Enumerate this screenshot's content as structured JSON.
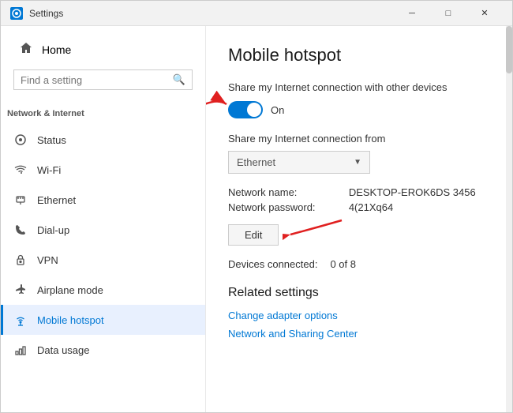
{
  "window": {
    "title": "Settings",
    "icon": "⚙"
  },
  "titlebar": {
    "minimize": "─",
    "maximize": "□",
    "close": "✕"
  },
  "sidebar": {
    "home_label": "Home",
    "search_placeholder": "Find a setting",
    "section_title": "Network & Internet",
    "items": [
      {
        "id": "status",
        "label": "Status",
        "icon": "◎"
      },
      {
        "id": "wifi",
        "label": "Wi-Fi",
        "icon": "📶"
      },
      {
        "id": "ethernet",
        "label": "Ethernet",
        "icon": "🖧"
      },
      {
        "id": "dialup",
        "label": "Dial-up",
        "icon": "☎"
      },
      {
        "id": "vpn",
        "label": "VPN",
        "icon": "🔒"
      },
      {
        "id": "airplane",
        "label": "Airplane mode",
        "icon": "✈"
      },
      {
        "id": "hotspot",
        "label": "Mobile hotspot",
        "icon": "📡"
      },
      {
        "id": "datausage",
        "label": "Data usage",
        "icon": "📊"
      }
    ]
  },
  "content": {
    "page_title": "Mobile hotspot",
    "share_label": "Share my Internet connection with other devices",
    "toggle_state": "On",
    "share_from_label": "Share my Internet connection from",
    "dropdown_value": "Ethernet",
    "network_name_key": "Network name:",
    "network_name_value": "DESKTOP-EROK6DS 3456",
    "network_password_key": "Network password:",
    "network_password_value": "4(21Xq64",
    "edit_button": "Edit",
    "devices_connected_key": "Devices connected:",
    "devices_connected_value": "0 of 8",
    "related_settings_title": "Related settings",
    "link1": "Change adapter options",
    "link2": "Network and Sharing Center"
  }
}
